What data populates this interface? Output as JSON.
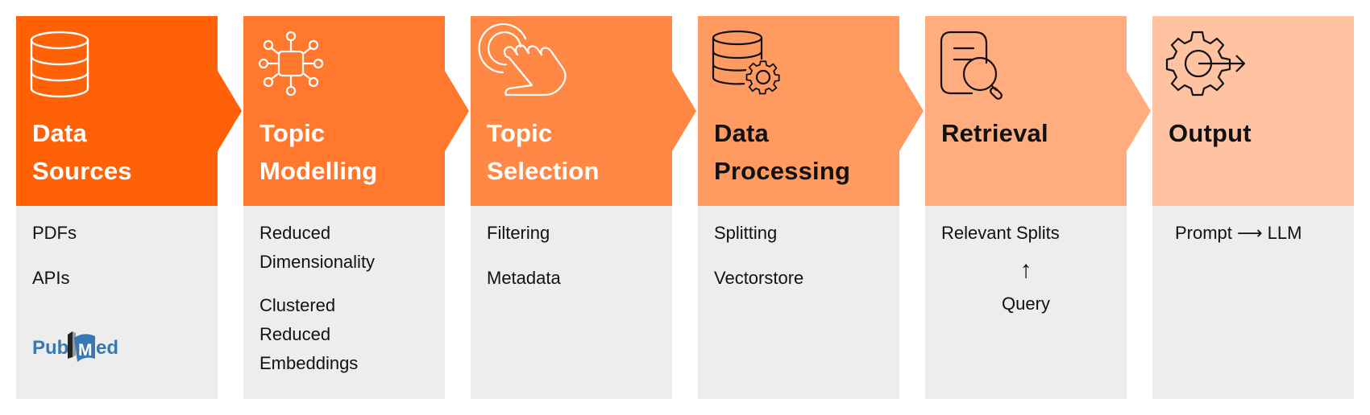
{
  "diagram": {
    "type": "pipeline",
    "stages": [
      {
        "id": "data-sources",
        "title": "Data\nSources",
        "icon": "database-icon",
        "header_color": "#ff6107",
        "title_color": "#ffffff",
        "items": [
          "PDFs",
          "APIs"
        ],
        "logo": {
          "name": "PubMed",
          "text_left": "Pub",
          "text_right": "ed",
          "letter": "M",
          "color": "#3a78b4"
        }
      },
      {
        "id": "topic-modelling",
        "title": "Topic\nModelling",
        "icon": "network-nodes-icon",
        "header_color": "#ff782e",
        "title_color": "#ffffff",
        "items": [
          "Reduced\nDimensionality",
          "Clustered\nReduced\nEmbeddings"
        ]
      },
      {
        "id": "topic-selection",
        "title": "Topic\nSelection",
        "icon": "touch-hand-icon",
        "header_color": "#ff8844",
        "title_color": "#ffffff",
        "items": [
          "Filtering",
          "Metadata"
        ]
      },
      {
        "id": "data-processing",
        "title": "Data\nProcessing",
        "icon": "database-gear-icon",
        "header_color": "#ff9a61",
        "title_color": "#111111",
        "items": [
          "Splitting",
          "Vectorstore"
        ]
      },
      {
        "id": "retrieval",
        "title": "Retrieval",
        "icon": "document-search-icon",
        "header_color": "#ffad7f",
        "title_color": "#111111",
        "items": [
          "Relevant Splits"
        ],
        "flow": {
          "arrow": "↑",
          "source": "Query"
        }
      },
      {
        "id": "output",
        "title": "Output",
        "icon": "gear-output-icon",
        "header_color": "#ffc3a1",
        "title_color": "#111111",
        "items": [
          "Prompt ⟶ LLM"
        ]
      }
    ],
    "body_color": "#ededed"
  }
}
